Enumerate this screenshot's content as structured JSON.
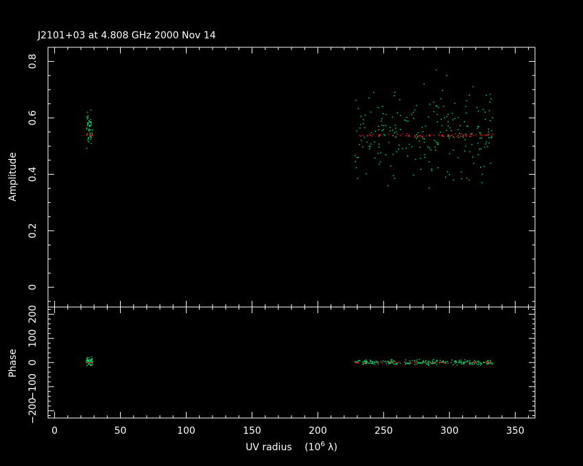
{
  "chart_data": {
    "type": "scatter",
    "title": "J2101+03 at 4.808 GHz 2000 Nov 14",
    "xlabel": "UV radius",
    "xlabel_unit": "(10",
    "xlabel_unit_exp": "6",
    "xlabel_unit_tail": " λ)",
    "xlim": [
      -5,
      365
    ],
    "x_ticks": [
      0,
      50,
      100,
      150,
      200,
      250,
      300,
      350
    ],
    "colors": {
      "background": "#000000",
      "axes": "#ffffff",
      "observed": "#00e070",
      "model": "#e02020"
    },
    "panels": [
      {
        "name": "amplitude",
        "ylabel": "Amplitude",
        "ylim": [
          -0.07,
          0.85
        ],
        "y_ticks": [
          0,
          0.2,
          0.4,
          0.6,
          0.8
        ],
        "y_tick_labels": [
          "0",
          "0.2",
          "0.4",
          "0.6",
          "0.8"
        ],
        "series": [
          {
            "role": "observed",
            "color": "#00e070",
            "clusters": [
              {
                "x_range": [
                  24,
                  29
                ],
                "y_mean": 0.56,
                "y_spread": 0.03,
                "count": 50
              },
              {
                "x_range": [
                  228,
                  334
                ],
                "y_mean": 0.54,
                "y_spread": 0.075,
                "count": 230
              }
            ],
            "points": [
              [
                290,
                0.77
              ],
              [
                298,
                0.75
              ],
              [
                318,
                0.71
              ],
              [
                328,
                0.68
              ],
              [
                303,
                0.38
              ],
              [
                315,
                0.38
              ],
              [
                325,
                0.4
              ],
              [
                322,
                0.47
              ]
            ]
          },
          {
            "role": "model",
            "color": "#e02020",
            "clusters": [
              {
                "x_range": [
                  24,
                  29
                ],
                "y_mean": 0.54,
                "y_spread": 0.002,
                "count": 10
              },
              {
                "x_range": [
                  228,
                  334
                ],
                "y_mean": 0.538,
                "y_spread": 0.003,
                "count": 90
              }
            ],
            "points": []
          }
        ]
      },
      {
        "name": "phase",
        "ylabel": "Phase",
        "ylim": [
          -230,
          230
        ],
        "y_ticks": [
          -200,
          -100,
          0,
          100,
          200
        ],
        "y_tick_labels": [
          "−200",
          "−100",
          "0",
          "100",
          "200"
        ],
        "series": [
          {
            "role": "observed",
            "color": "#00e070",
            "clusters": [
              {
                "x_range": [
                  24,
                  29
                ],
                "y_mean": 5,
                "y_spread": 8,
                "count": 50
              },
              {
                "x_range": [
                  228,
                  334
                ],
                "y_mean": 0,
                "y_spread": 5,
                "count": 230
              }
            ],
            "points": []
          },
          {
            "role": "model",
            "color": "#e02020",
            "clusters": [
              {
                "x_range": [
                  24,
                  29
                ],
                "y_mean": 0,
                "y_spread": 1,
                "count": 8
              },
              {
                "x_range": [
                  228,
                  334
                ],
                "y_mean": 0,
                "y_spread": 2,
                "count": 60
              }
            ],
            "points": []
          }
        ]
      }
    ]
  }
}
